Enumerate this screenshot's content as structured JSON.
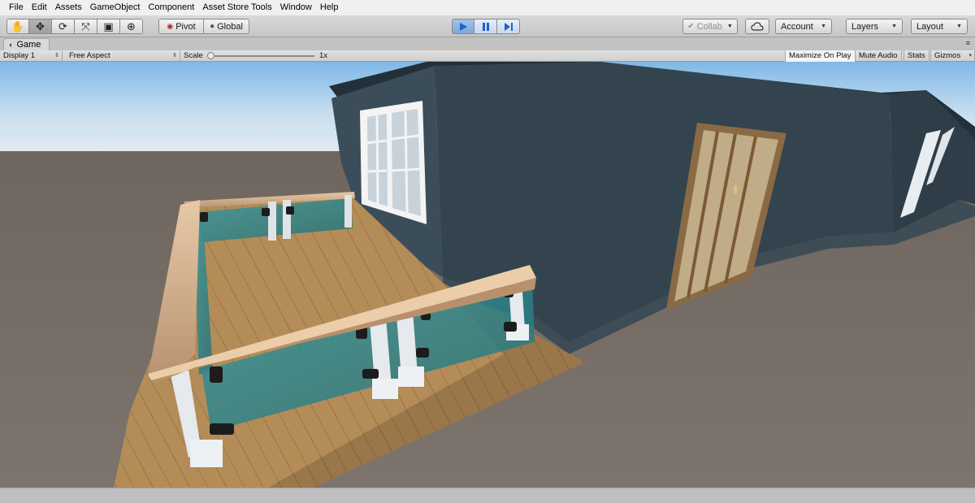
{
  "menu": [
    "File",
    "Edit",
    "Assets",
    "GameObject",
    "Component",
    "Asset Store Tools",
    "Window",
    "Help"
  ],
  "toolbar": {
    "transform_tools": [
      {
        "name": "hand-tool-icon",
        "glyph": "✋",
        "active": false
      },
      {
        "name": "move-tool-icon",
        "glyph": "✥",
        "active": true
      },
      {
        "name": "rotate-tool-icon",
        "glyph": "⟳",
        "active": false
      },
      {
        "name": "scale-tool-icon",
        "glyph": "⤧",
        "active": false
      },
      {
        "name": "rect-tool-icon",
        "glyph": "▣",
        "active": false
      },
      {
        "name": "transform-tool-icon",
        "glyph": "⊕",
        "active": false
      }
    ],
    "pivot_label": "Pivot",
    "global_label": "Global",
    "collab_label": "Collab",
    "account_label": "Account",
    "layers_label": "Layers",
    "layout_label": "Layout"
  },
  "tab": {
    "title": "Game"
  },
  "game_bar": {
    "display": "Display 1",
    "aspect": "Free Aspect",
    "scale_label": "Scale",
    "scale_value": "1x",
    "maximize_on_play": "Maximize On Play",
    "mute_audio": "Mute Audio",
    "stats": "Stats",
    "gizmos": "Gizmos"
  },
  "colors": {
    "play_accent": "#1f62c9",
    "house_wall": "#33444f",
    "deck_wood": "#b08a54",
    "glass": "#2f7f86"
  }
}
